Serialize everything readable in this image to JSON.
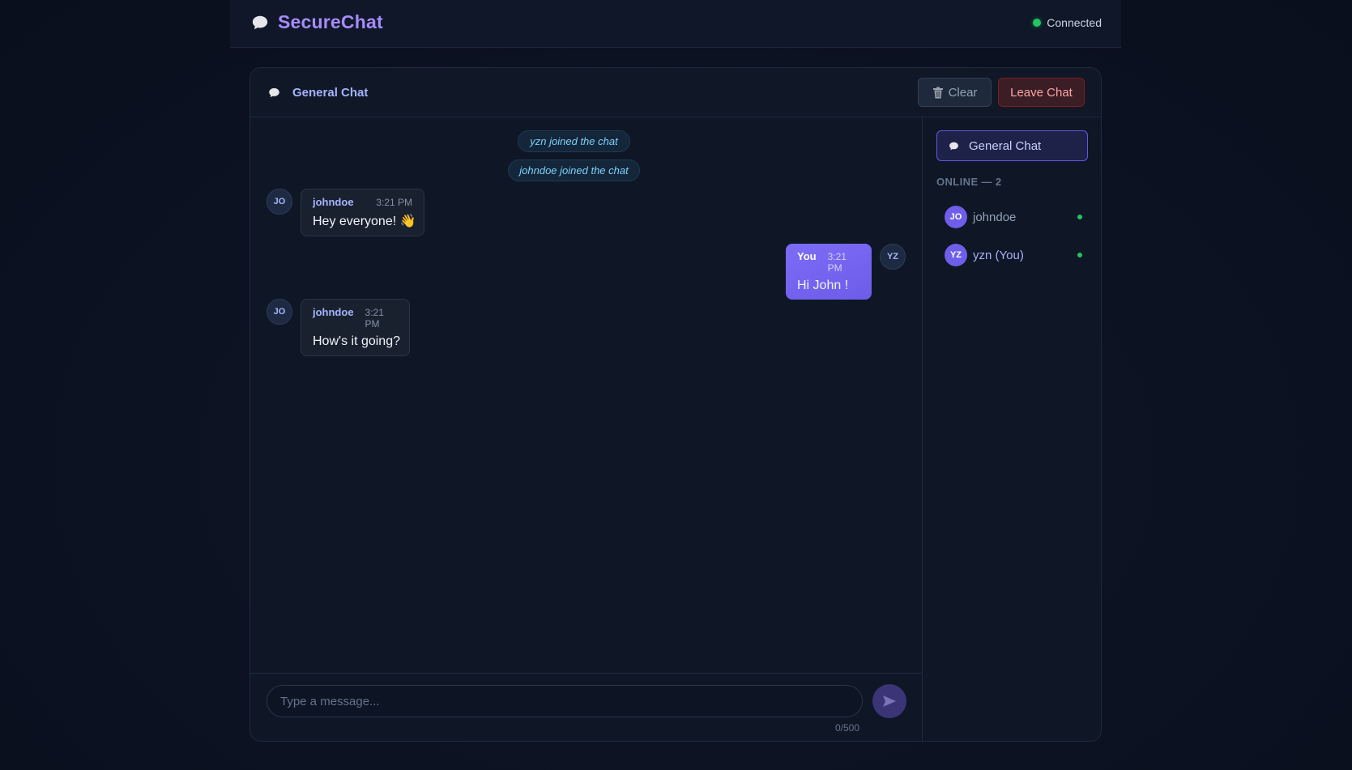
{
  "app": {
    "title": "SecureChat",
    "status": "Connected"
  },
  "room": {
    "title": "General Chat"
  },
  "header": {
    "clear_label": "Clear",
    "leave_label": "Leave Chat"
  },
  "system_messages": [
    "yzn joined the chat",
    "johndoe joined the chat"
  ],
  "messages": [
    {
      "avatar": "JO",
      "sender": "johndoe",
      "time": "3:21 PM",
      "text": "Hey everyone! 👋",
      "mine": false
    },
    {
      "avatar": "YZ",
      "sender": "You",
      "time": "3:21 PM",
      "text": "Hi John !",
      "mine": true
    },
    {
      "avatar": "JO",
      "sender": "johndoe",
      "time": "3:21 PM",
      "text": "How's it going?",
      "mine": false
    }
  ],
  "composer": {
    "placeholder": "Type a message...",
    "value": "",
    "counter": "0/500"
  },
  "sidebar": {
    "room_label": "General Chat",
    "online_header": "ONLINE — 2",
    "users": [
      {
        "initials": "JO",
        "name": "johndoe"
      },
      {
        "initials": "YZ",
        "name": "yzn (You)"
      }
    ]
  },
  "colors": {
    "accent": "#a78bfa",
    "own_bubble": "#7c6cf6",
    "online": "#22c55e",
    "leave": "#fca5a5"
  }
}
